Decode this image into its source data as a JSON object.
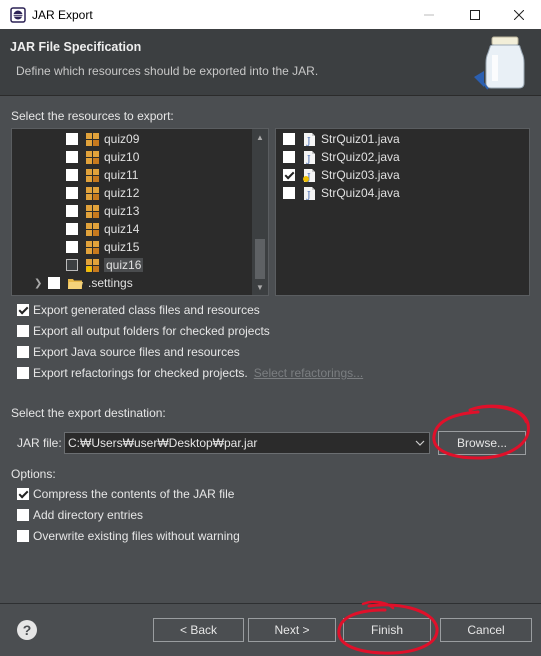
{
  "window": {
    "title": "JAR Export",
    "controls": {
      "minimize": "—",
      "maximize": "☐",
      "close": "✕"
    }
  },
  "header": {
    "title": "JAR File Specification",
    "description": "Define which resources should be exported into the JAR."
  },
  "resources": {
    "label": "Select the resources to export:",
    "tree": [
      {
        "label": "quiz09",
        "checked": false
      },
      {
        "label": "quiz10",
        "checked": false
      },
      {
        "label": "quiz11",
        "checked": false
      },
      {
        "label": "quiz12",
        "checked": false
      },
      {
        "label": "quiz13",
        "checked": false
      },
      {
        "label": "quiz14",
        "checked": false
      },
      {
        "label": "quiz15",
        "checked": false
      },
      {
        "label": "quiz16",
        "checked": false,
        "selected": true
      },
      {
        "label": ".settings",
        "checked": false,
        "folder": true
      }
    ],
    "files": [
      {
        "label": "StrQuiz01.java",
        "checked": false
      },
      {
        "label": "StrQuiz02.java",
        "checked": false
      },
      {
        "label": "StrQuiz03.java",
        "checked": true
      },
      {
        "label": "StrQuiz04.java",
        "checked": false
      }
    ]
  },
  "options_top": [
    {
      "label": "Export generated class files and resources",
      "checked": true
    },
    {
      "label": "Export all output folders for checked projects",
      "checked": false
    },
    {
      "label": "Export Java source files and resources",
      "checked": false
    },
    {
      "label": "Export refactorings for checked projects.",
      "checked": false
    }
  ],
  "select_refactorings": "Select refactorings...",
  "destination": {
    "label": "Select the export destination:",
    "jar_file_label": "JAR file:",
    "jar_file_value": "C:₩Users₩user₩Desktop₩par.jar",
    "browse": "Browse..."
  },
  "options": {
    "label": "Options:",
    "items": [
      {
        "label": "Compress the contents of the JAR file",
        "checked": true
      },
      {
        "label": "Add directory entries",
        "checked": false
      },
      {
        "label": "Overwrite existing files without warning",
        "checked": false
      }
    ]
  },
  "footer": {
    "help": "?",
    "back": "< Back",
    "next": "Next >",
    "finish": "Finish",
    "cancel": "Cancel"
  },
  "colors": {
    "dialog_bg": "#4b4e51",
    "header_bg": "#3c3f41",
    "panel_bg": "#2b2b2b",
    "annotation_red": "#e0102a"
  }
}
